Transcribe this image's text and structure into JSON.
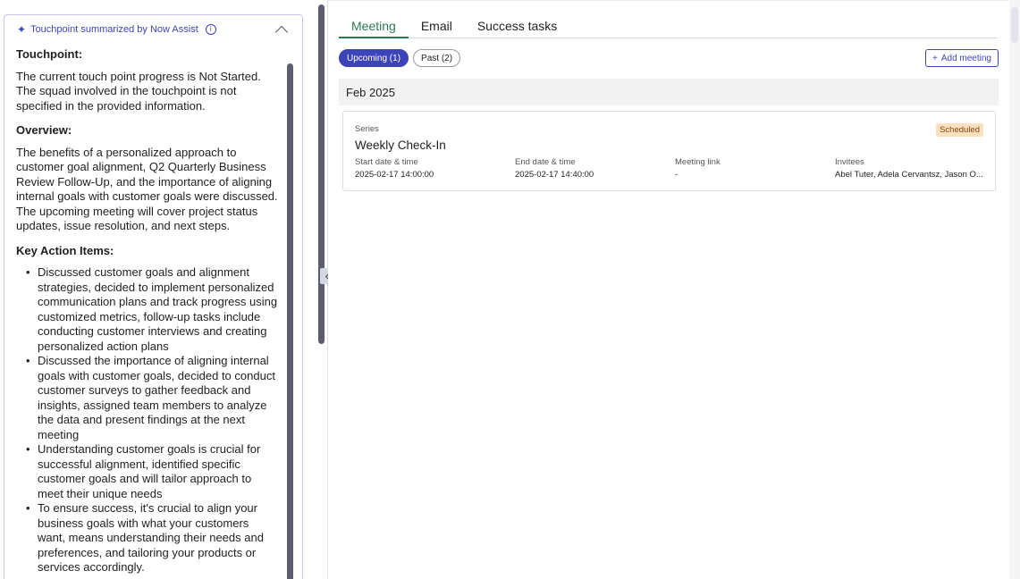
{
  "summary": {
    "header_title": "Touchpoint summarized by Now Assist",
    "touchpoint_heading": "Touchpoint:",
    "touchpoint_text": "The current touch point progress is Not Started. The squad involved in the touchpoint is not specified in the provided information.",
    "overview_heading": "Overview:",
    "overview_text": "The benefits of a personalized approach to customer goal alignment, Q2 Quarterly Business Review Follow-Up, and the importance of aligning internal goals with customer goals were discussed. The upcoming meeting will cover project status updates, issue resolution, and next steps.",
    "action_heading": "Key Action Items:",
    "action_items": [
      "Discussed customer goals and alignment strategies, decided to implement personalized communication plans and track progress using customized metrics, follow-up tasks include conducting customer interviews and creating personalized action plans",
      "Discussed the importance of aligning internal goals with customer goals, decided to conduct customer surveys to gather feedback and insights, assigned team members to analyze the data and present findings at the next meeting",
      "Understanding customer goals is crucial for successful alignment, identified specific customer goals and will tailor approach to meet their unique needs",
      "To ensure success, it's crucial to align your business goals with what your customers want, means understanding their needs and preferences, and tailoring your products or services accordingly."
    ]
  },
  "tabs": [
    "Meeting",
    "Email",
    "Success tasks"
  ],
  "filters": {
    "upcoming": "Upcoming (1)",
    "past": "Past (2)"
  },
  "add_meeting": "Add meeting",
  "month": "Feb 2025",
  "meeting": {
    "series_label": "Series",
    "title": "Weekly Check-In",
    "status": "Scheduled",
    "start_label": "Start date & time",
    "start_value": "2025-02-17 14:00:00",
    "end_label": "End date & time",
    "end_value": "2025-02-17 14:40:00",
    "link_label": "Meeting link",
    "link_value": "-",
    "invitees_label": "Invitees",
    "invitees_value": "Abel Tuter, Adela Cervantsz, Jason O..."
  },
  "colors": {
    "accent": "#3d44b8",
    "active_tab": "#2a7a51",
    "badge_bg": "#fce0bf"
  }
}
